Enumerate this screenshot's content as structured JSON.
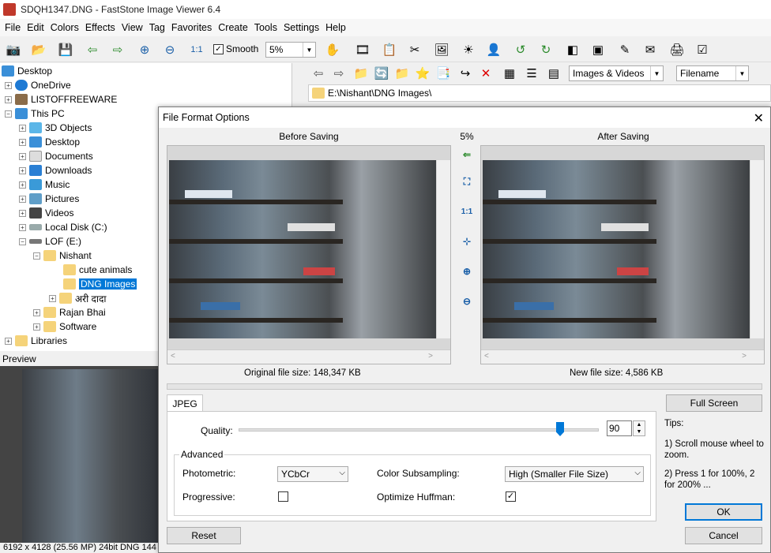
{
  "window": {
    "title": "SDQH1347.DNG  -  FastStone Image Viewer 6.4"
  },
  "menu": [
    "File",
    "Edit",
    "Colors",
    "Effects",
    "View",
    "Tag",
    "Favorites",
    "Create",
    "Tools",
    "Settings",
    "Help"
  ],
  "toolbar": {
    "smooth_label": "Smooth",
    "smooth_checked": "✓",
    "zoom_value": "5%"
  },
  "tree": {
    "desktop": "Desktop",
    "onedrive": "OneDrive",
    "listoffreeware": "LISTOFFREEWARE",
    "this_pc": "This PC",
    "objects3d": "3D Objects",
    "desktop2": "Desktop",
    "documents": "Documents",
    "downloads": "Downloads",
    "music": "Music",
    "pictures": "Pictures",
    "videos": "Videos",
    "local_disk": "Local Disk (C:)",
    "lof": "LOF (E:)",
    "nishant": "Nishant",
    "cute_animals": "cute animals",
    "dng_images": "DNG Images",
    "hindi": "अरी दादा",
    "rajan": "Rajan Bhai",
    "software": "Software",
    "libraries": "Libraries"
  },
  "preview_label": "Preview",
  "status": "6192 x 4128 (25.56 MP)  24bit  DNG   144",
  "filter": {
    "type": "Images & Videos",
    "sort": "Filename"
  },
  "path": "E:\\Nishant\\DNG Images\\",
  "dialog": {
    "title": "File Format Options",
    "before_label": "Before Saving",
    "after_label": "After Saving",
    "zoom": "5%",
    "one_to_one": "1:1",
    "original_size": "Original file size:  148,347 KB",
    "new_size": "New file size:  4,586 KB",
    "tab": "JPEG",
    "quality_label": "Quality:",
    "quality_value": "90",
    "advanced_label": "Advanced",
    "photometric_label": "Photometric:",
    "photometric_value": "YCbCr",
    "subsampling_label": "Color Subsampling:",
    "subsampling_value": "High (Smaller File Size)",
    "progressive_label": "Progressive:",
    "huffman_label": "Optimize Huffman:",
    "huffman_checked": "✓",
    "fullscreen": "Full Screen",
    "tips_title": "Tips:",
    "tip1": "1) Scroll mouse wheel to zoom.",
    "tip2": "2) Press 1 for 100%, 2 for 200% ...",
    "ok": "OK",
    "cancel": "Cancel",
    "reset": "Reset"
  }
}
